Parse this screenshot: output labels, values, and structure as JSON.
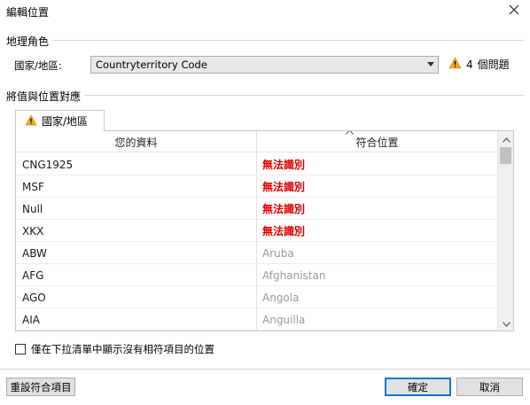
{
  "dialog": {
    "title": "編輯位置"
  },
  "geo_role": {
    "section_label": "地理角色",
    "country_label": "國家/地區:",
    "country_value": "Countryterritory Code",
    "issues_count": "4",
    "issues_text": "個問題"
  },
  "mapping": {
    "section_label": "將值與位置對應",
    "tab_label": "國家/地區",
    "columns": {
      "your_data": "您的資料",
      "matching": "符合位置"
    },
    "rows": [
      {
        "value": "CNG1925",
        "match": "無法識別",
        "status": "unrecognized"
      },
      {
        "value": "MSF",
        "match": "無法識別",
        "status": "unrecognized"
      },
      {
        "value": "Null",
        "match": "無法識別",
        "status": "unrecognized"
      },
      {
        "value": "XKX",
        "match": "無法識別",
        "status": "unrecognized"
      },
      {
        "value": "ABW",
        "match": "Aruba",
        "status": "matched"
      },
      {
        "value": "AFG",
        "match": "Afghanistan",
        "status": "matched"
      },
      {
        "value": "AGO",
        "match": "Angola",
        "status": "matched"
      },
      {
        "value": "AIA",
        "match": "Anguilla",
        "status": "matched"
      }
    ]
  },
  "options": {
    "show_unmatched_label": "僅在下拉清單中顯示沒有相符項目的位置",
    "show_unmatched_checked": false
  },
  "buttons": {
    "reset": "重設符合項目",
    "ok": "確定",
    "cancel": "取消"
  },
  "colors": {
    "unrecognized": "#e00000",
    "matched": "#9a9a9a",
    "warning": "#f5a623",
    "primary_border": "#0078d7"
  },
  "icons": {
    "warning": "warning-icon",
    "close": "close-icon",
    "dropdown": "chevron-down-icon"
  }
}
